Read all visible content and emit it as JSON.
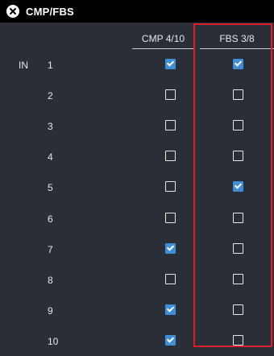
{
  "window": {
    "title": "CMP/FBS",
    "close_icon": "close-circle-icon"
  },
  "columns": {
    "cmp_label": "CMP 4/10",
    "fbs_label": "FBS 3/8"
  },
  "group_label": "IN",
  "rows": [
    {
      "num": "1",
      "cmp": true,
      "fbs": true
    },
    {
      "num": "2",
      "cmp": false,
      "fbs": false
    },
    {
      "num": "3",
      "cmp": false,
      "fbs": false
    },
    {
      "num": "4",
      "cmp": false,
      "fbs": false
    },
    {
      "num": "5",
      "cmp": false,
      "fbs": true
    },
    {
      "num": "6",
      "cmp": false,
      "fbs": false
    },
    {
      "num": "7",
      "cmp": true,
      "fbs": false
    },
    {
      "num": "8",
      "cmp": false,
      "fbs": false
    },
    {
      "num": "9",
      "cmp": true,
      "fbs": false
    },
    {
      "num": "10",
      "cmp": true,
      "fbs": false
    }
  ],
  "colors": {
    "background": "#2a2e36",
    "checked": "#3f8fd8",
    "highlight": "#d8202a"
  }
}
